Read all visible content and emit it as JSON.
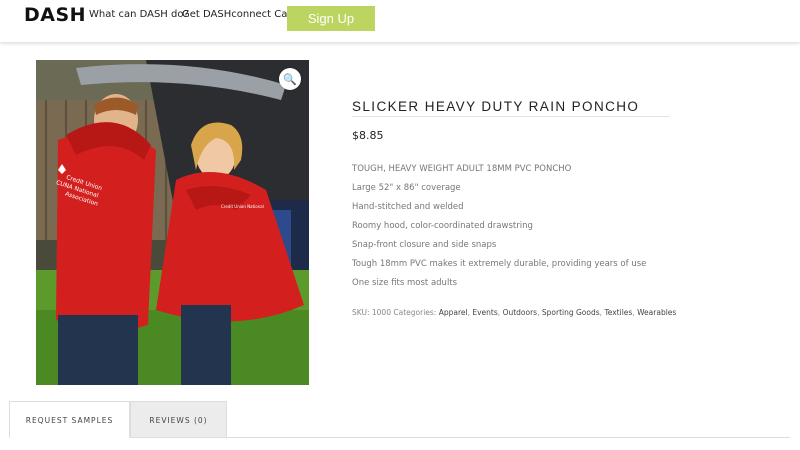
{
  "header": {
    "logo": "DASH",
    "nav": [
      "What can DASH do?",
      "Get DASHconnect Card"
    ],
    "signup_label": "Sign Up"
  },
  "product": {
    "title": "SLICKER HEAVY DUTY RAIN PONCHO",
    "price": "$8.85",
    "description": [
      "TOUGH, HEAVY WEIGHT ADULT 18MM PVC PONCHO",
      "Large 52\" x 86\" coverage",
      "Hand-stitched and welded",
      "Roomy hood, color-coordinated drawstring",
      "Snap-front closure and side snaps",
      "Tough 18mm PVC makes it extremely durable, providing years of use",
      "One size fits most adults"
    ],
    "sku_label": "SKU:",
    "sku": "1000",
    "categories_label": "Categories:",
    "categories": [
      "Apparel",
      "Events",
      "Outdoors",
      "Sporting Goods",
      "Textiles",
      "Wearables"
    ],
    "image_print_text": "Credit Union National Association",
    "zoom_icon": "magnifier-icon"
  },
  "tabs": [
    "REQUEST SAMPLES",
    "REVIEWS (0)"
  ],
  "colors": {
    "signup_bg": "#bcd560",
    "poncho_red": "#d3201e",
    "tab_inactive_bg": "#ececec"
  }
}
